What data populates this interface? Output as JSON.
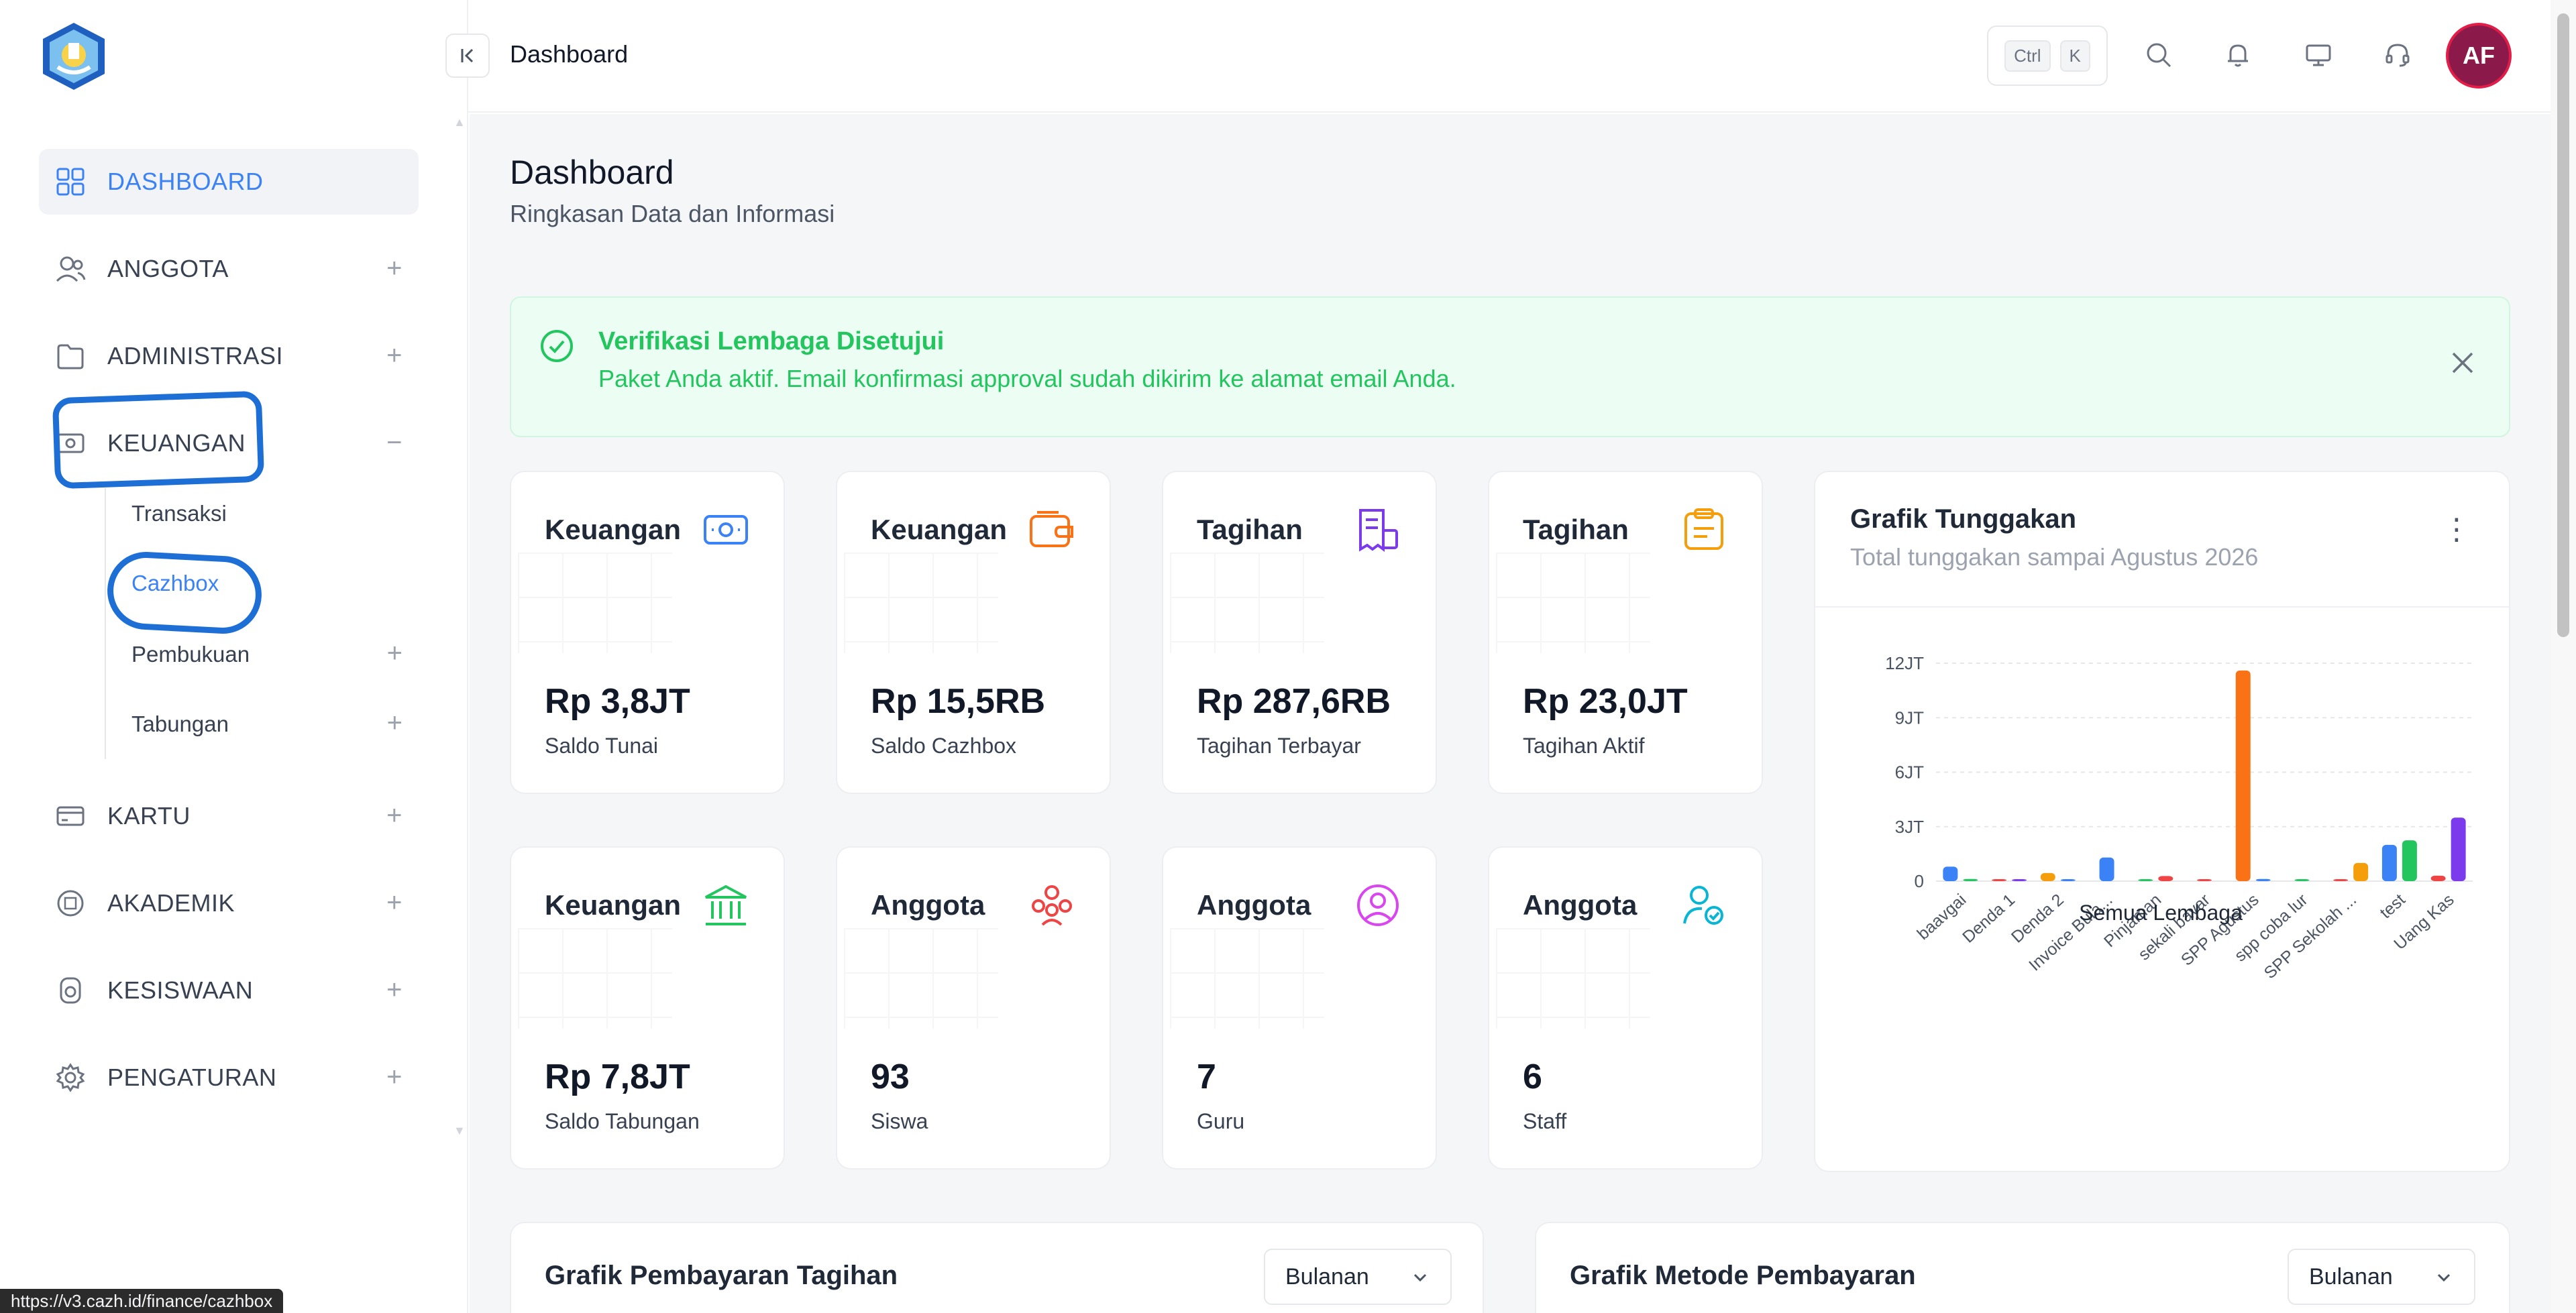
{
  "sidebar": {
    "nav": [
      {
        "label": "DASHBOARD",
        "icon": "grid-icon",
        "active": true
      },
      {
        "label": "ANGGOTA",
        "icon": "users-icon"
      },
      {
        "label": "ADMINISTRASI",
        "icon": "folder-icon"
      },
      {
        "label": "KEUANGAN",
        "icon": "money-icon"
      },
      {
        "label": "KARTU",
        "icon": "card-icon"
      },
      {
        "label": "AKADEMIK",
        "icon": "book-icon"
      },
      {
        "label": "KESISWAAN",
        "icon": "student-icon"
      },
      {
        "label": "PENGATURAN",
        "icon": "gear-icon"
      }
    ],
    "keuangan_sub": [
      {
        "label": "Transaksi"
      },
      {
        "label": "Cazhbox",
        "active": true
      },
      {
        "label": "Pembukuan"
      },
      {
        "label": "Tabungan"
      }
    ],
    "status_url": "https://v3.cazh.id/finance/cazhbox"
  },
  "header": {
    "title": "Dashboard",
    "shortcut": [
      "Ctrl",
      "K"
    ],
    "avatar_initials": "AF"
  },
  "page": {
    "title": "Dashboard",
    "subtitle": "Ringkasan Data dan Informasi"
  },
  "alert": {
    "title": "Verifikasi Lembaga Disetujui",
    "text": "Paket Anda aktif. Email konfirmasi approval sudah dikirim ke alamat email Anda."
  },
  "cards": [
    {
      "label": "Keuangan",
      "value": "Rp 3,8JT",
      "sub": "Saldo Tunai",
      "icon": "cash-icon",
      "color": "#3b82f6"
    },
    {
      "label": "Keuangan",
      "value": "Rp 15,5RB",
      "sub": "Saldo Cazhbox",
      "icon": "wallet-icon",
      "color": "#f97316"
    },
    {
      "label": "Tagihan",
      "value": "Rp 287,6RB",
      "sub": "Tagihan Terbayar",
      "icon": "invoice-icon",
      "color": "#7c3aed"
    },
    {
      "label": "Tagihan",
      "value": "Rp 23,0JT",
      "sub": "Tagihan Aktif",
      "icon": "clipboard-icon",
      "color": "#f59e0b"
    },
    {
      "label": "Keuangan",
      "value": "Rp 7,8JT",
      "sub": "Saldo Tabungan",
      "icon": "bank-icon",
      "color": "#22c55e"
    },
    {
      "label": "Anggota",
      "value": "93",
      "sub": "Siswa",
      "icon": "group-icon",
      "color": "#ef4444"
    },
    {
      "label": "Anggota",
      "value": "7",
      "sub": "Guru",
      "icon": "user-circle-icon",
      "color": "#d946ef"
    },
    {
      "label": "Anggota",
      "value": "6",
      "sub": "Staff",
      "icon": "user-check-icon",
      "color": "#06b6d4"
    }
  ],
  "chart_card": {
    "title": "Grafik Tunggakan",
    "subtitle": "Total tunggakan sampai Agustus 2026"
  },
  "chart_data": {
    "type": "bar",
    "title": "Grafik Tunggakan",
    "xlabel": "Semua Lembaga",
    "ylabel": "",
    "ylim": [
      0,
      12000000
    ],
    "yticks": [
      "0",
      "3JT",
      "6JT",
      "9JT",
      "12JT"
    ],
    "grid": true,
    "categories": [
      "baavgai",
      "Denda 1",
      "Denda 2",
      "Invoice Bula...",
      "Pinjaman",
      "sekali bayar",
      "SPP Agustus",
      "spp coba lur",
      "SPP Sekolah ...",
      "test",
      "Uang Kas"
    ],
    "category_groups": [
      [
        {
          "v": 800000,
          "c": "#3b82f6"
        },
        {
          "v": 120000,
          "c": "#22c55e"
        }
      ],
      [
        {
          "v": 60000,
          "c": "#ef4444"
        },
        {
          "v": 60000,
          "c": "#7c3aed"
        }
      ],
      [
        {
          "v": 450000,
          "c": "#f59e0b"
        },
        {
          "v": 40000,
          "c": "#3b82f6"
        }
      ],
      [
        {
          "v": 1300000,
          "c": "#3b82f6"
        }
      ],
      [
        {
          "v": 50000,
          "c": "#22c55e"
        },
        {
          "v": 280000,
          "c": "#ef4444"
        }
      ],
      [
        {
          "v": 60000,
          "c": "#ef4444"
        }
      ],
      [
        {
          "v": 11600000,
          "c": "#f97316"
        },
        {
          "v": 120000,
          "c": "#3b82f6"
        }
      ],
      [
        {
          "v": 60000,
          "c": "#22c55e"
        }
      ],
      [
        {
          "v": 50000,
          "c": "#ef4444"
        },
        {
          "v": 1000000,
          "c": "#f59e0b"
        }
      ],
      [
        {
          "v": 2000000,
          "c": "#3b82f6"
        },
        {
          "v": 2250000,
          "c": "#22c55e"
        }
      ],
      [
        {
          "v": 300000,
          "c": "#ef4444"
        },
        {
          "v": 3500000,
          "c": "#7c3aed"
        }
      ]
    ]
  },
  "bottom": [
    {
      "title": "Grafik Pembayaran Tagihan",
      "select": "Bulanan"
    },
    {
      "title": "Grafik Metode Pembayaran",
      "select": "Bulanan"
    }
  ]
}
